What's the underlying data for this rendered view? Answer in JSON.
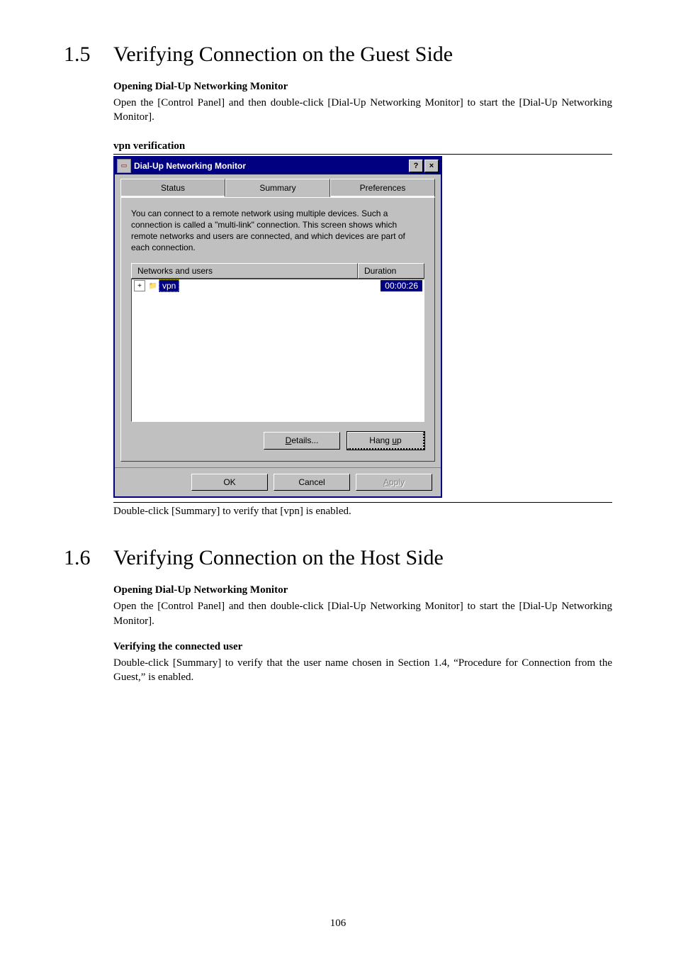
{
  "section_1_5": {
    "number": "1.5",
    "title": "Verifying Connection on the Guest Side",
    "sub1_title": "Opening Dial-Up Networking Monitor",
    "sub1_body": "Open the [Control Panel] and then double-click [Dial-Up Networking Monitor] to start the [Dial-Up Networking Monitor].",
    "caption": "vpn verification",
    "footnote": "Double-click [Summary] to verify that [vpn] is enabled."
  },
  "dialog": {
    "title": "Dial-Up Networking Monitor",
    "help_glyph": "?",
    "close_glyph": "×",
    "tabs": {
      "status": "Status",
      "summary": "Summary",
      "preferences": "Preferences"
    },
    "description": "You can connect to a remote network using multiple devices. Such a connection is called a \"multi-link\" connection. This screen shows which remote networks and users are connected, and which devices are part of each connection.",
    "col_networks": "Networks and users",
    "col_duration": "Duration",
    "row_expand": "+",
    "row_name": "vpn",
    "row_duration": "00:00:26",
    "btn_details_pre": "D",
    "btn_details_rest": "etails...",
    "btn_hangup_pre": "Hang ",
    "btn_hangup_u": "u",
    "btn_hangup_post": "p",
    "btn_ok": "OK",
    "btn_cancel": "Cancel",
    "btn_apply_pre": "A",
    "btn_apply_rest": "pply"
  },
  "section_1_6": {
    "number": "1.6",
    "title": "Verifying Connection on the Host Side",
    "sub1_title": "Opening Dial-Up Networking Monitor",
    "sub1_body": "Open the [Control Panel] and then double-click [Dial-Up Networking Monitor] to start the [Dial-Up Networking Monitor].",
    "sub2_title": "Verifying the connected user",
    "sub2_body": "Double-click [Summary] to verify that the user name chosen in Section 1.4, “Procedure for Connection from the Guest,” is enabled."
  },
  "page_number": "106"
}
